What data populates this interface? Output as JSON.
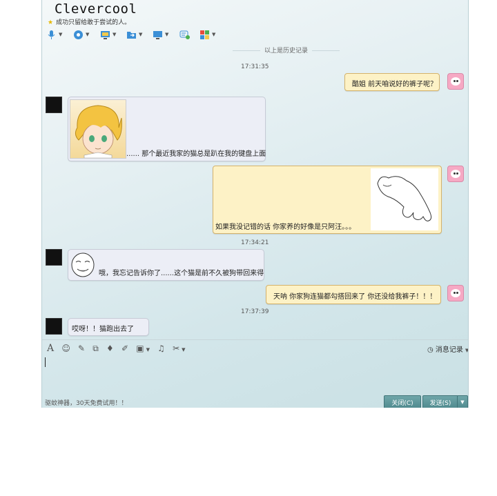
{
  "window": {
    "title": "Clevercool",
    "signature": "成功只留给敢于尝试的人。"
  },
  "toolbar": {
    "icons": [
      "mic-icon",
      "video-icon",
      "screen-share-icon",
      "folder-icon",
      "remote-desktop-icon",
      "chat-add-icon",
      "apps-icon"
    ]
  },
  "chat": {
    "history_label": "以上是历史记录",
    "messages": [
      {
        "timestamp": "17:31:35"
      },
      {
        "text": "酷姐 前天咱说好的裤子呢？"
      },
      {
        "text": "...... 那个最近我家的猫总是趴在我的键盘上面"
      },
      {
        "text": "如果我没记错的话 你家养的好像是只阿汪。。。"
      },
      {
        "timestamp": "17:34:21"
      },
      {
        "text": "哦，我忘记告诉你了......这个猫是前不久被狗带回来得"
      },
      {
        "text": "天呐 你家狗连猫都勾搭回来了 你还没给我裤子！！！"
      },
      {
        "timestamp": "17:37:39"
      },
      {
        "text": "哎呀！！猫跑出去了"
      }
    ]
  },
  "input_toolbar": {
    "history_button": "消息记录"
  },
  "footer": {
    "ad_text": "驱蚊神器，30天免费试用！！",
    "close_button": "关闭(C)",
    "send_button": "发送(S)"
  }
}
